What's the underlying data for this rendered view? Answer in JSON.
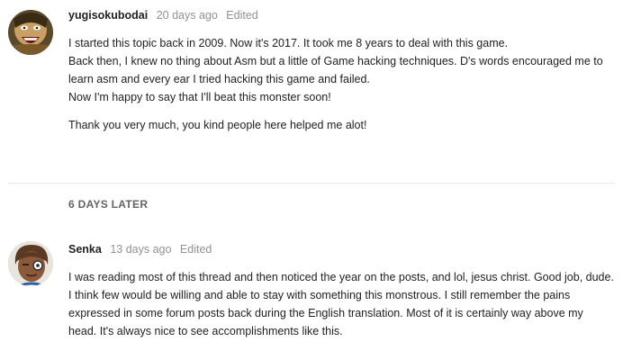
{
  "posts": [
    {
      "username": "yugisokubodai",
      "age": "20 days ago",
      "edited": "Edited",
      "paragraphs": [
        "I started this topic back in 2009. Now it's 2017. It took me 8 years to deal with this game.",
        "Back then, I knew no thing about Asm but a little of Game hacking techniques. D's words encouraged me to learn asm and every ear I tried hacking this game and failed.",
        "Now I'm happy to say that I'll beat this monster soon!",
        "Thank you very much, you kind people here helped me alot!"
      ]
    },
    {
      "username": "Senka",
      "age": "13 days ago",
      "edited": "Edited",
      "paragraphs": [
        "I was reading most of this thread and then noticed the year on the posts, and lol, jesus christ. Good job, dude. I think few would be willing and able to stay with something this monstrous. I still remember the pains expressed in some forum posts back during the English translation. Most of it is certainly way above my head. It's always nice to see accomplishments like this."
      ]
    }
  ],
  "time_gap": "6 DAYS LATER",
  "colors": {
    "divider": "#e9e9e9",
    "meta": "#919191",
    "gap": "#646464"
  }
}
